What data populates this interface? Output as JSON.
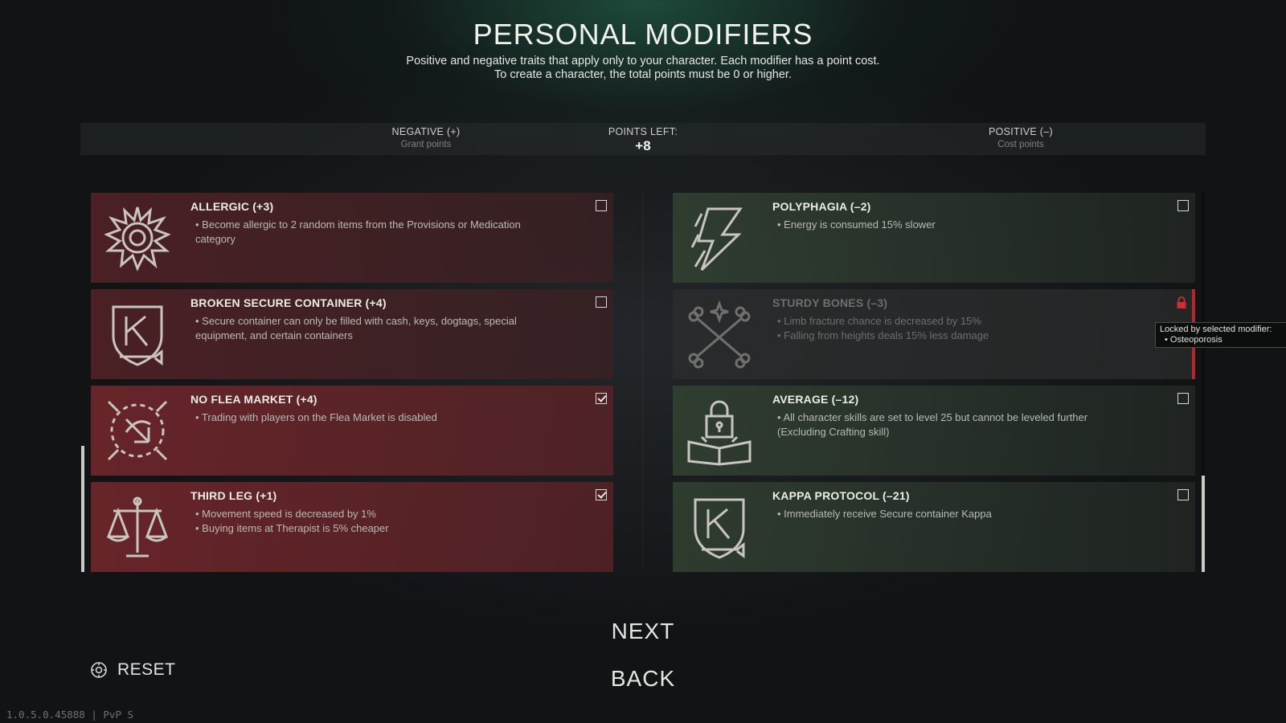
{
  "header": {
    "title": "PERSONAL MODIFIERS",
    "subtitle_line1": "Positive and negative traits that apply only to your character. Each modifier has a point cost.",
    "subtitle_line2": "To create a character, the total points must be 0 or higher."
  },
  "summary": {
    "negative_label": "NEGATIVE (+)",
    "negative_sub": "Grant points",
    "points_label": "POINTS LEFT:",
    "points_value": "+8",
    "positive_label": "POSITIVE (–)",
    "positive_sub": "Cost points"
  },
  "negative_modifiers": [
    {
      "title": "ALLERGIC (+3)",
      "lines": [
        "• Become allergic to 2 random items from the Provisions or Medication",
        "category"
      ],
      "checked": false,
      "icon": "sun-burst-icon"
    },
    {
      "title": "BROKEN SECURE CONTAINER (+4)",
      "lines": [
        "• Secure container can only be filled with cash, keys, dogtags, special",
        "equipment, and certain containers"
      ],
      "checked": false,
      "icon": "kappa-shield-icon"
    },
    {
      "title": "NO FLEA MARKET (+4)",
      "lines": [
        "• Trading with players on the Flea Market is disabled"
      ],
      "checked": true,
      "icon": "flea-market-icon"
    },
    {
      "title": "THIRD LEG (+1)",
      "lines": [
        "• Movement speed is decreased by 1%",
        "• Buying items at Therapist is 5% cheaper"
      ],
      "checked": true,
      "icon": "scales-icon"
    }
  ],
  "positive_modifiers": [
    {
      "title": "POLYPHAGIA (–2)",
      "lines": [
        "• Energy is consumed 15% slower"
      ],
      "checked": false,
      "icon": "lightning-icon"
    },
    {
      "title": "STURDY BONES (–3)",
      "lines": [
        "• Limb fracture chance is decreased by 15%",
        "• Falling from heights deals 15% less damage"
      ],
      "checked": false,
      "locked": true,
      "icon": "crossed-bones-icon"
    },
    {
      "title": "AVERAGE (–12)",
      "lines": [
        "• All character skills are set to level 25 but cannot be leveled further",
        "(Excluding Crafting skill)"
      ],
      "checked": false,
      "icon": "locked-book-icon"
    },
    {
      "title": "KAPPA PROTOCOL (–21)",
      "lines": [
        "• Immediately receive Secure container Kappa"
      ],
      "checked": false,
      "icon": "kappa-shield-icon"
    }
  ],
  "tooltip": {
    "heading": "Locked by selected modifier:",
    "item": "• Osteoporosis"
  },
  "buttons": {
    "next": "NEXT",
    "back": "BACK",
    "reset": "RESET"
  },
  "version": "1.0.5.0.45888 | PvP S",
  "colors": {
    "negative_card": "#5a2428",
    "positive_card": "#344434",
    "locked_accent": "#b3262c"
  }
}
